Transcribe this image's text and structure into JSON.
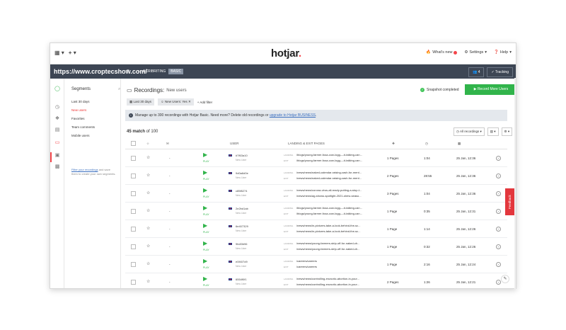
{
  "topbar": {
    "logo": "hotjar",
    "add_label": "+",
    "whats_new": "What's new",
    "settings": "Settings",
    "help": "Help"
  },
  "sitebar": {
    "url": "https://www.croptecshow.com/",
    "plan_name": "ACRIBRITING",
    "plan_badge": "BASIC",
    "users_count": "4",
    "tracking": "Tracking"
  },
  "segments": {
    "title": "Segments",
    "items": [
      {
        "label": "Last 30 days",
        "active": false
      },
      {
        "label": "New users",
        "active": true
      },
      {
        "label": "Favorites",
        "active": false
      },
      {
        "label": "Team comments",
        "active": false
      },
      {
        "label": "Mobile users",
        "active": false
      }
    ],
    "note_link": "Filter your recordings",
    "note_rest": " and save them to create your own segments."
  },
  "main": {
    "title": "Recordings:",
    "subtitle": "New users",
    "snapshot": "Snapshot completed",
    "record_button": "Record More Users",
    "filter1": "Last 30 days",
    "filter2": "New Users: Yes",
    "add_filter": "+ Add filter",
    "banner_pre": "Manage up to 300 recordings with Hotjar Basic. Need more? Delete old recordings or ",
    "banner_link": "upgrade to Hotjar BUSINESS",
    "banner_post": ".",
    "match_count": "45 match",
    "match_total": " of 100",
    "sort": "All recordings",
    "columns": {
      "user": "USER",
      "landing": "LANDING & EXIT PAGES"
    },
    "landing_label": "LANDING",
    "exit_label": "EXIT",
    "play_label": "PLAY",
    "new_user_label": "New User",
    "rows": [
      {
        "dash": "-",
        "id": "#7f63a10",
        "landing": "/blogs/young-farmer-fusa-cow-logg-–-#-talking-can...",
        "exit": "/blogs/young-farmer-fusa-cow-logg-–-#-talking-can...",
        "pages": "1 Pages",
        "duration": "1:04",
        "date": "25 Jan, 12:36"
      },
      {
        "dash": "-",
        "id": "9d0a6d0e",
        "landing": "/news/news/naked-calendar-raising-cash-for-ment...",
        "exit": "/news/news/naked-calendar-raising-cash-for-ment...",
        "pages": "2 Pages",
        "duration": "28:55",
        "date": "25 Jan, 12:36"
      },
      {
        "dash": "-",
        "id": "c85f8274",
        "landing": "/news/news/corona-virus-all-ready-putting-a-stop-t...",
        "exit": "/news/news/ag-shows-spotlight-2021-shew-seaso...",
        "pages": "3 Pages",
        "duration": "1:04",
        "date": "25 Jan, 12:36"
      },
      {
        "dash": "-",
        "id": "2e2bd1ab",
        "landing": "/blogs/young-farmer-fusa-cow-logg-–-#-talking-can...",
        "exit": "/blogs/young-farmer-fusa-cow-logg-–-#-talking-can...",
        "pages": "1 Page",
        "duration": "0:35",
        "date": "25 Jan, 12:31"
      },
      {
        "dash": "-",
        "id": "6e407329",
        "landing": "/news/news/in-pictures-take-a-look-behind-the-sc...",
        "exit": "/news/news/in-pictures-take-a-look-behind-the-sc...",
        "pages": "1 Page",
        "duration": "1:14",
        "date": "25 Jan, 12:26"
      },
      {
        "dash": "-",
        "id": "9fc83b96",
        "landing": "/news/news/young-farmers-strip-off-for-naked-ch...",
        "exit": "/news/news/young-farmers-strip-off-for-naked-ch...",
        "pages": "1 Page",
        "duration": "0:32",
        "date": "25 Jan, 12:26"
      },
      {
        "dash": "-",
        "id": "e0f407d9",
        "landing": "/careers/careers",
        "exit": "/careers/careers",
        "pages": "1 Page",
        "duration": "2:16",
        "date": "25 Jan, 12:24"
      },
      {
        "dash": "-",
        "id": "6554f0f1",
        "landing": "/news/news/controlling-enzootic-abortion-in-your...",
        "exit": "/news/news/controlling-enzootic-abortion-in-your...",
        "pages": "2 Pages",
        "duration": "1:26",
        "date": "25 Jan, 12:21"
      }
    ]
  },
  "feedback": "Feedback",
  "colors": {
    "accent_green": "#31b44b",
    "brand_red": "#f4464b",
    "sitebar": "#3d4654"
  }
}
